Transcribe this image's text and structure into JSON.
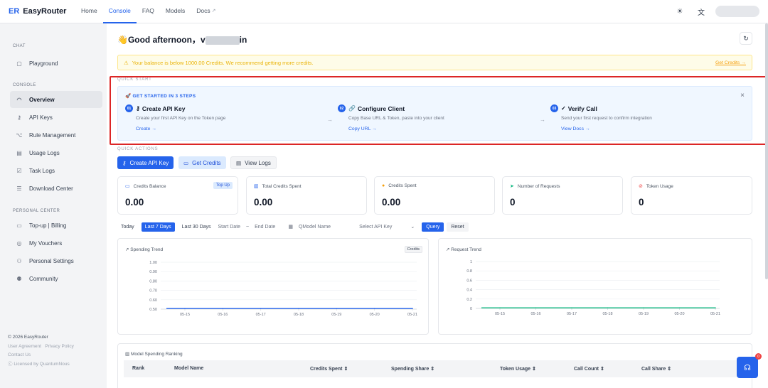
{
  "app": {
    "brand_mark": "ER",
    "name": "EasyRouter"
  },
  "nav": [
    {
      "label": "Home"
    },
    {
      "label": "Console",
      "active": true
    },
    {
      "label": "FAQ"
    },
    {
      "label": "Models"
    },
    {
      "label": "Docs"
    }
  ],
  "sidebar": {
    "chat_title": "CHAT",
    "chat_items": [
      {
        "label": "Playground",
        "icon": "playground-icon"
      }
    ],
    "console_title": "CONSOLE",
    "console_items": [
      {
        "label": "Overview",
        "icon": "gauge-icon",
        "active": true
      },
      {
        "label": "API Keys",
        "icon": "key-icon"
      },
      {
        "label": "Rule Management",
        "icon": "rules-icon"
      },
      {
        "label": "Usage Logs",
        "icon": "document-icon"
      },
      {
        "label": "Task Logs",
        "icon": "task-icon"
      },
      {
        "label": "Download Center",
        "icon": "list-icon"
      }
    ],
    "personal_title": "PERSONAL CENTER",
    "personal_items": [
      {
        "label": "Top-up | Billing",
        "icon": "wallet-icon"
      },
      {
        "label": "My Vouchers",
        "icon": "voucher-icon"
      },
      {
        "label": "Personal Settings",
        "icon": "user-icon"
      },
      {
        "label": "Community",
        "icon": "community-icon"
      }
    ],
    "footer": {
      "copyright": "© 2026 EasyRouter",
      "user_agreement": "User Agreement",
      "privacy": "Privacy Policy",
      "contact": "Contact Us",
      "license": "Licensed by QuantumNous"
    }
  },
  "greeting": {
    "prefix": "👋Good afternoon，",
    "name_start": "v",
    "name_end": "in"
  },
  "warning": {
    "text": "Your balance is below 1000.00 Credits. We recommend getting more credits.",
    "link": "Get Credits →"
  },
  "quick_start": {
    "section_label": "QUICK START",
    "heading": "🚀 GET STARTED IN 3 STEPS",
    "steps": [
      {
        "num": "01",
        "title": "Create API Key",
        "desc": "Create your first API Key on the Token page",
        "link": "Create →"
      },
      {
        "num": "02",
        "title": "Configure Client",
        "desc": "Copy Base URL & Token, paste into your client",
        "link": "Copy URL →"
      },
      {
        "num": "03",
        "title": "Verify Call",
        "desc": "Send your first request to confirm integration",
        "link": "View Docs →"
      }
    ]
  },
  "quick_actions": {
    "section_label": "QUICK ACTIONS",
    "create": "Create API Key",
    "get_credits": "Get Credits",
    "view_logs": "View Logs"
  },
  "stats": [
    {
      "label": "Credits Balance",
      "value": "0.00",
      "icon": "wallet-icon",
      "color": "#2563eb"
    },
    {
      "label": "Total Credits Spent",
      "value": "0.00",
      "icon": "bar-chart-icon",
      "color": "#2563eb"
    },
    {
      "label": "Credits Spent",
      "value": "0.00",
      "icon": "coin-icon",
      "color": "#f59e0b"
    },
    {
      "label": "Number of Requests",
      "value": "0",
      "icon": "send-icon",
      "color": "#10b981"
    },
    {
      "label": "Token Usage",
      "value": "0",
      "icon": "token-icon",
      "color": "#ef4444"
    }
  ],
  "topup_label": "Top Up",
  "filters": {
    "today": "Today",
    "last7": "Last 7 Days",
    "last30": "Last 30 Days",
    "start_date": "Start Date",
    "sep": "~",
    "end_date": "End Date",
    "model_placeholder": "Model Name",
    "api_key_placeholder": "Select API Key",
    "query": "Query",
    "reset": "Reset"
  },
  "spending_chart_title": "Spending Trend",
  "spending_badge": "Credits",
  "request_chart_title": "Request Trend",
  "chart_data": [
    {
      "type": "line",
      "title": "Spending Trend",
      "x": [
        "05-15",
        "05-16",
        "05-17",
        "05-18",
        "05-19",
        "05-20",
        "05-21"
      ],
      "y_ticks": [
        "1.00",
        "0.90",
        "0.80",
        "0.70",
        "0.60",
        "0.50"
      ],
      "ylim": [
        0.5,
        1.0
      ],
      "series": [
        {
          "values": [
            0.5,
            0.5,
            0.5,
            0.5,
            0.5,
            0.5,
            0.5
          ],
          "color": "#2563eb"
        }
      ],
      "grid": true
    },
    {
      "type": "line",
      "title": "Request Trend",
      "x": [
        "05-15",
        "05-16",
        "05-17",
        "05-18",
        "05-19",
        "05-20",
        "05-21"
      ],
      "y_ticks": [
        "1",
        "0.8",
        "0.6",
        "0.4",
        "0.2",
        "0"
      ],
      "ylim": [
        0,
        1
      ],
      "series": [
        {
          "values": [
            0,
            0,
            0,
            0,
            0,
            0,
            0
          ],
          "color": "#10b981"
        }
      ],
      "grid": true
    }
  ],
  "ranking": {
    "title": "Model Spending Ranking",
    "columns": [
      "Rank",
      "Model Name",
      "Credits Spent",
      "Spending Share",
      "Token Usage",
      "Call Count",
      "Call Share"
    ]
  },
  "support_badge": "0"
}
